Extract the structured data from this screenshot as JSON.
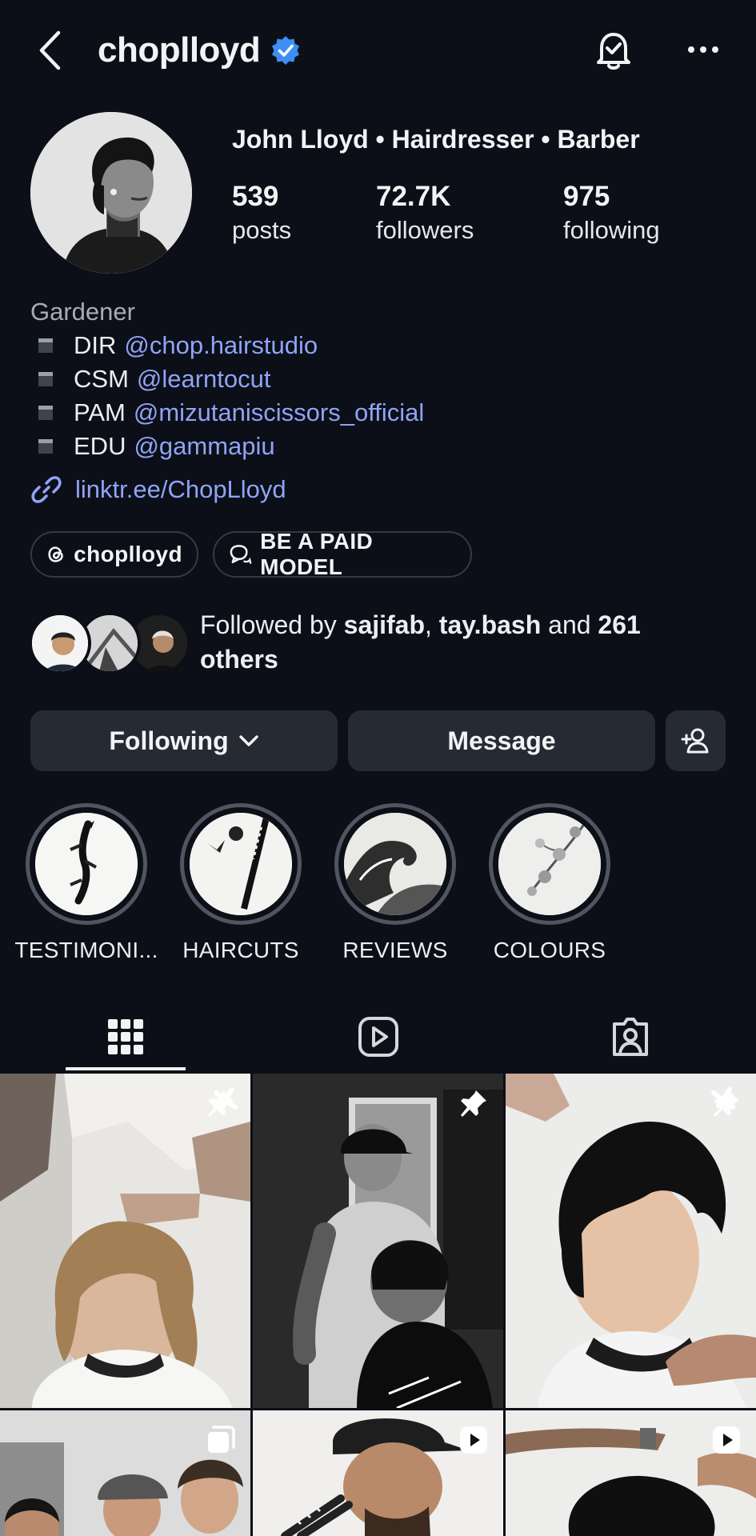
{
  "header": {
    "username": "choplloyd"
  },
  "profile": {
    "full_name": "John Lloyd • Hairdresser • Barber",
    "stats": [
      {
        "value": "539",
        "label": "posts"
      },
      {
        "value": "72.7K",
        "label": "followers"
      },
      {
        "value": "975",
        "label": "following"
      }
    ],
    "category": "Gardener",
    "bio_lines": [
      {
        "prefix": "DIR",
        "mention": "@chop.hairstudio"
      },
      {
        "prefix": "CSM",
        "mention": "@learntocut"
      },
      {
        "prefix": "PAM",
        "mention": "@mizutaniscissors_official"
      },
      {
        "prefix": "EDU",
        "mention": "@gammapiu"
      }
    ],
    "link": "linktr.ee/ChopLloyd",
    "pills": {
      "threads": "choplloyd",
      "paid_model": "BE A PAID MODEL"
    }
  },
  "followed_by": {
    "prefix": "Followed by ",
    "user1": "sajifab",
    "sep": ", ",
    "user2": "tay.bash",
    "and": " and ",
    "count": "261",
    "suffix": "others"
  },
  "actions": {
    "following": "Following",
    "message": "Message"
  },
  "highlights": [
    {
      "label": "TESTIMONI..."
    },
    {
      "label": "HAIRCUTS"
    },
    {
      "label": "REVIEWS"
    },
    {
      "label": "COLOURS"
    }
  ],
  "tabs": [
    "posts-grid",
    "reels",
    "tagged"
  ],
  "colors": {
    "background": "#0c0f17",
    "mention": "#8fa4f6",
    "verified": "#3d8ff5",
    "button": "#262a33"
  }
}
